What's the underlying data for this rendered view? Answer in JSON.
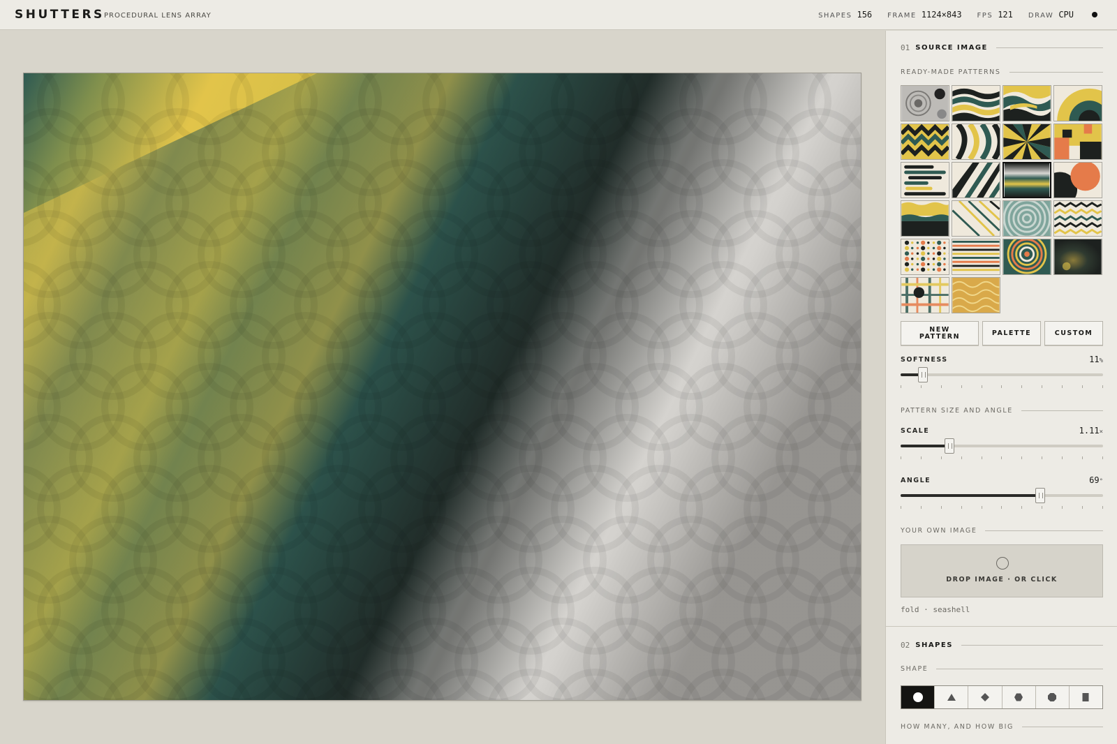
{
  "header": {
    "brand": "SHUTTERS",
    "subtitle": "PROCEDURAL LENS ARRAY",
    "stats": [
      {
        "label": "SHAPES",
        "value": "156"
      },
      {
        "label": "FRAME",
        "value": "1124×843"
      },
      {
        "label": "FPS",
        "value": "121"
      },
      {
        "label": "DRAW",
        "value": "CPU"
      }
    ],
    "status_icon": "status-dot-icon"
  },
  "canvas": {
    "palette": {
      "teal": "#2f5a52",
      "yellow": "#e2c44a",
      "dark": "#1d211f",
      "light": "#d9d7d3"
    }
  },
  "panel": {
    "section1": {
      "number": "01",
      "title": "SOURCE IMAGE"
    },
    "ready_made": "READY-MADE PATTERNS",
    "patterns": [
      {
        "name": "halftone-rings"
      },
      {
        "name": "waves-teal"
      },
      {
        "name": "waves-yellow"
      },
      {
        "name": "arches"
      },
      {
        "name": "zigzag"
      },
      {
        "name": "swirl-stripes"
      },
      {
        "name": "sunburst"
      },
      {
        "name": "blocks"
      },
      {
        "name": "pill-stripes"
      },
      {
        "name": "diagonal-bars"
      },
      {
        "name": "horizon-gradient",
        "selected": true
      },
      {
        "name": "sun-circle"
      },
      {
        "name": "layers"
      },
      {
        "name": "soft-diagonals"
      },
      {
        "name": "concentric"
      },
      {
        "name": "squiggle-lines"
      },
      {
        "name": "dots"
      },
      {
        "name": "fine-stripes"
      },
      {
        "name": "radial-glow"
      },
      {
        "name": "dark-glow"
      },
      {
        "name": "plaid"
      },
      {
        "name": "gold-waves"
      }
    ],
    "buttons": {
      "new_pattern": "NEW PATTERN",
      "palette": "PALETTE",
      "custom": "CUSTOM"
    },
    "softness": {
      "label": "SOFTNESS",
      "value": "11",
      "unit": "%",
      "level": 0.11
    },
    "pattern_size_angle": "PATTERN SIZE AND ANGLE",
    "scale": {
      "label": "SCALE",
      "value": "1.11",
      "unit": "×",
      "level": 0.24
    },
    "angle": {
      "label": "ANGLE",
      "value": "69",
      "unit": "°",
      "level": 0.69
    },
    "own_image": "YOUR OWN IMAGE",
    "drop_label": "DROP IMAGE · OR CLICK",
    "file_tag": "fold · seashell",
    "section2": {
      "number": "02",
      "title": "SHAPES"
    },
    "shape_label": "SHAPE",
    "shape_options": [
      "circle-icon",
      "triangle-icon",
      "diamond-icon",
      "hexagon-icon",
      "octagon-icon",
      "rectangle-icon"
    ],
    "how_many": "HOW MANY, AND HOW BIG"
  }
}
